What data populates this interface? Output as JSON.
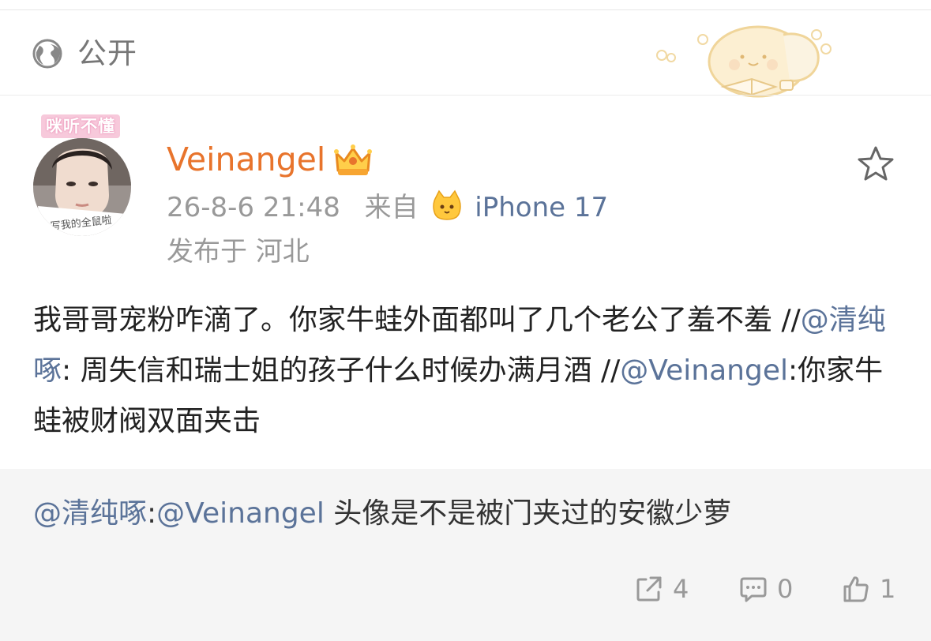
{
  "header": {
    "visibility_label": "公开",
    "icon": "globe-icon",
    "decoration": "hamster-reading-illustration"
  },
  "post": {
    "badge": "咪听不懂",
    "username": "Veinangel",
    "username_color": "#e8742c",
    "vip_icon": "crown-icon",
    "timestamp": "26-8-6 21:48",
    "source_prefix": "来自",
    "source_icon": "cat-emoji-icon",
    "device": "iPhone 17",
    "location": "发布于 河北",
    "star_icon": "star-icon",
    "content": {
      "part1": "我哥哥宠粉咋滴了。你家牛蛙外面都叫了几个老公了羞不羞 //",
      "mention1": "@清纯啄",
      "part2": ": 周失信和瑞士姐的孩子什么时候办满月酒 //",
      "mention2": "@Veinangel",
      "part3": ":你家牛蛙被财阀双面夹击"
    },
    "mention_color": "#5b7399"
  },
  "reply": {
    "mention1": "@清纯啄",
    "sep": ":",
    "mention2": "@Veinangel",
    "text": " 头像是不是被门夹过的安徽少萝"
  },
  "actions": {
    "share_icon": "share-icon",
    "share_count": "4",
    "comment_icon": "comment-icon",
    "comment_count": "0",
    "like_icon": "thumbs-up-icon",
    "like_count": "1"
  }
}
